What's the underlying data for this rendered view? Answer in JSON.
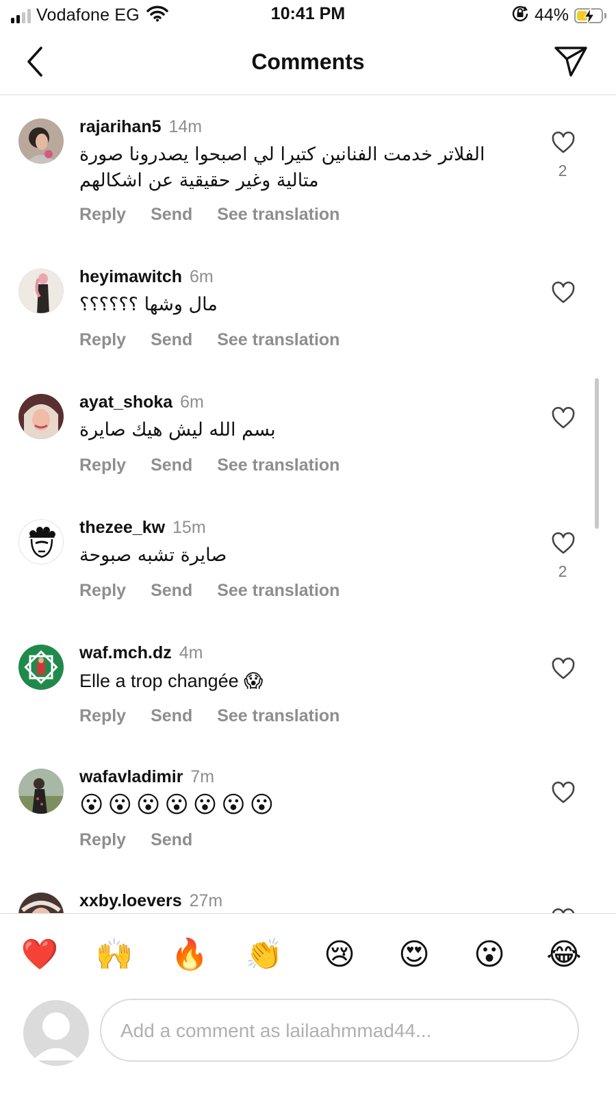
{
  "status_bar": {
    "carrier": "Vodafone EG",
    "time": "10:41 PM",
    "battery_percent": "44%",
    "battery_level": 0.44,
    "signal_bars": 2,
    "icons": [
      "signal-icon",
      "wifi-icon",
      "orientation-lock-icon",
      "battery-charging-icon"
    ]
  },
  "header": {
    "title": "Comments",
    "back_icon": "chevron-left-icon",
    "share_icon": "paper-plane-icon"
  },
  "comments": [
    {
      "username": "rajarihan5",
      "time": "14m",
      "text": "الفلاتر خدمت الفنانين كتيرا لي اصبحوا يصدرونا صورة متالية وغير حقيقية عن اشكالهم",
      "likes": "2",
      "actions": [
        "Reply",
        "Send",
        "See translation"
      ]
    },
    {
      "username": "heyimawitch",
      "time": "6m",
      "text": "مال وشها ؟؟؟؟؟؟",
      "likes": "",
      "actions": [
        "Reply",
        "Send",
        "See translation"
      ]
    },
    {
      "username": "ayat_shoka",
      "time": "6m",
      "text": "بسم الله ليش هيك صايرة",
      "likes": "",
      "actions": [
        "Reply",
        "Send",
        "See translation"
      ]
    },
    {
      "username": "thezee_kw",
      "time": "15m",
      "text": "صايرة تشبه صبوحة",
      "likes": "2",
      "actions": [
        "Reply",
        "Send",
        "See translation"
      ]
    },
    {
      "username": "waf.mch.dz",
      "time": "4m",
      "text": "Elle a trop changée 😱",
      "likes": "",
      "actions": [
        "Reply",
        "Send",
        "See translation"
      ]
    },
    {
      "username": "wafavladimir",
      "time": "7m",
      "text": "😮😮😮😮😮😮😮",
      "likes": "",
      "actions": [
        "Reply",
        "Send"
      ]
    },
    {
      "username": "xxby.loevers",
      "time": "27m"
    }
  ],
  "reactions": [
    "❤️",
    "🙌",
    "🔥",
    "👏",
    "😢",
    "😍",
    "😮",
    "😂"
  ],
  "composer": {
    "placeholder": "Add a comment as lailaahmmad44..."
  }
}
